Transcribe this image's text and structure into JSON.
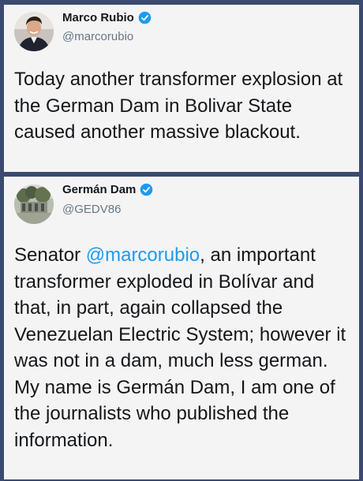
{
  "tweets": [
    {
      "author": {
        "display_name": "Marco Rubio",
        "handle": "@marcorubio",
        "verified": true,
        "avatar_icon": "person-photo-avatar"
      },
      "body": "Today another transformer explosion at the German Dam in Bolivar State caused another massive blackout."
    },
    {
      "author": {
        "display_name": "Germán Dam",
        "handle": "@GEDV86",
        "verified": true,
        "avatar_icon": "landscape-photo-avatar"
      },
      "body_prefix": "Senator ",
      "mention": "@marcorubio",
      "body_rest": ", an important transformer exploded in Bolívar and that, in part, again collapsed the Venezuelan Electric System; however it was not in a dam, much less german.",
      "body_second": "My name is Germán Dam, I am one of the journalists who published the information."
    }
  ],
  "colors": {
    "background": "#3a4a70",
    "card": "#f4f4f5",
    "verified_badge": "#1d9bf0",
    "mention": "#1d9bf0",
    "handle": "#657786",
    "text": "#14171a"
  }
}
